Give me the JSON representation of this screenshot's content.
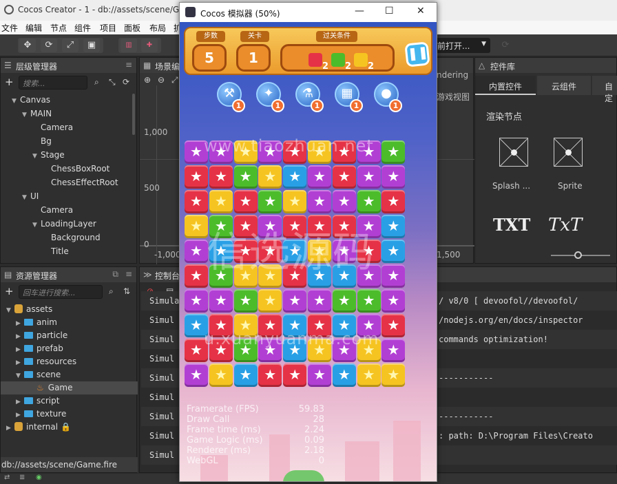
{
  "editor": {
    "title": "Cocos Creator - 1 - db://assets/scene/Game",
    "menu": [
      "文件",
      "编辑",
      "节点",
      "组件",
      "项目",
      "面板",
      "布局",
      "扩"
    ]
  },
  "toolbar": {
    "open_label": "前打开...",
    "buttons": [
      "move-icon",
      "rotate-icon",
      "scale-icon",
      "rect-icon"
    ]
  },
  "hierarchy": {
    "title": "层级管理器",
    "search_placeholder": "搜索...",
    "nodes": [
      {
        "label": "Canvas",
        "depth": 0,
        "expanded": true
      },
      {
        "label": "MAIN",
        "depth": 1,
        "expanded": true
      },
      {
        "label": "Camera",
        "depth": 2
      },
      {
        "label": "Bg",
        "depth": 2
      },
      {
        "label": "Stage",
        "depth": 2,
        "expanded": true
      },
      {
        "label": "ChessBoxRoot",
        "depth": 3
      },
      {
        "label": "ChessEffectRoot",
        "depth": 3
      },
      {
        "label": "UI",
        "depth": 1,
        "expanded": true
      },
      {
        "label": "Camera",
        "depth": 2
      },
      {
        "label": "LoadingLayer",
        "depth": 2,
        "expanded": true
      },
      {
        "label": "Background",
        "depth": 3
      },
      {
        "label": "Title",
        "depth": 3
      }
    ]
  },
  "scene": {
    "title": "场景编",
    "labels": {
      "y1000": "1,000",
      "y500": "500",
      "y0": "0",
      "xm1000": "-1,000",
      "x1500": "1,500",
      "rendering": "ndering",
      "view": "游戏视图"
    }
  },
  "assets": {
    "title": "资源管理器",
    "search_placeholder": "回车进行搜索...",
    "root": "assets",
    "items": [
      {
        "label": "anim"
      },
      {
        "label": "particle"
      },
      {
        "label": "prefab"
      },
      {
        "label": "resources"
      },
      {
        "label": "scene"
      },
      {
        "label": "Game"
      },
      {
        "label": "script"
      },
      {
        "label": "texture"
      }
    ],
    "internal": "internal",
    "footer_path": "db://assets/scene/Game.fire"
  },
  "widgets": {
    "title": "控件库",
    "tabs": [
      "内置控件",
      "云组件",
      "自定"
    ],
    "section": "渲染节点",
    "items": [
      "Splash ...",
      "Sprite"
    ],
    "txt1": "TXT",
    "txt2": "TxT"
  },
  "console": {
    "title": "控制台",
    "rows": [
      {
        "left": "Simula",
        "right": "/ v8/0 [ devoofol//devoofol/"
      },
      {
        "left": "Simul",
        "right": "/nodejs.org/en/docs/inspector"
      },
      {
        "left": "Simul",
        "right": "commands optimization!"
      },
      {
        "left": "Simul",
        "right": ""
      },
      {
        "left": "Simul",
        "right": "-----------"
      },
      {
        "left": "Simul",
        "right": ""
      },
      {
        "left": "Simul",
        "right": "-----------"
      },
      {
        "left": "Simul",
        "right": ": path: D:\\Program Files\\Creato"
      },
      {
        "left": "Simul",
        "right": ""
      }
    ]
  },
  "simulator": {
    "title": "Cocos 模拟器 (50%)",
    "hud": {
      "steps_label": "步数",
      "steps_value": "5",
      "level_label": "关卡",
      "level_value": "1",
      "goal_label": "过关条件",
      "goals": [
        {
          "color": "#e63246",
          "count": "2"
        },
        {
          "color": "#4cbc2b",
          "count": "2"
        },
        {
          "color": "#f6c421",
          "count": "2"
        }
      ]
    },
    "props": [
      {
        "icon": "hammer-icon",
        "glyph": "🔨",
        "count": "1"
      },
      {
        "icon": "wand-icon",
        "glyph": "✦",
        "count": "1"
      },
      {
        "icon": "potion-icon",
        "glyph": "⚗",
        "count": "1"
      },
      {
        "icon": "shuffle-icon",
        "glyph": "▦",
        "count": "1"
      },
      {
        "icon": "bomb-icon",
        "glyph": "●",
        "count": "1"
      }
    ],
    "board": [
      [
        "pur",
        "pur",
        "yel",
        "pur",
        "red",
        "yel",
        "red",
        "pur",
        "grn"
      ],
      [
        "red",
        "red",
        "grn",
        "yel",
        "blu",
        "pur",
        "red",
        "pur",
        "pur"
      ],
      [
        "red",
        "yel",
        "red",
        "grn",
        "yel",
        "pur",
        "pur",
        "grn",
        "red"
      ],
      [
        "yel",
        "grn",
        "red",
        "pur",
        "red",
        "red",
        "red",
        "pur",
        "blu"
      ],
      [
        "pur",
        "blu",
        "red",
        "red",
        "blu",
        "yel",
        "pur",
        "red",
        "blu"
      ],
      [
        "red",
        "grn",
        "yel",
        "yel",
        "red",
        "blu",
        "blu",
        "pur",
        "pur"
      ],
      [
        "pur",
        "pur",
        "grn",
        "yel",
        "pur",
        "pur",
        "grn",
        "grn",
        "pur"
      ],
      [
        "blu",
        "red",
        "yel",
        "red",
        "blu",
        "red",
        "blu",
        "pur",
        "red"
      ],
      [
        "red",
        "red",
        "grn",
        "pur",
        "blu",
        "yel",
        "pur",
        "yel",
        "pur"
      ],
      [
        "pur",
        "yel",
        "blu",
        "red",
        "red",
        "pur",
        "blu",
        "yel",
        "yel"
      ]
    ],
    "stats": [
      {
        "label": "Framerate (FPS)",
        "value": "59.83"
      },
      {
        "label": "Draw Call",
        "value": "28"
      },
      {
        "label": "Frame time (ms)",
        "value": "2.24"
      },
      {
        "label": "Game Logic (ms)",
        "value": "0.09"
      },
      {
        "label": "Renderer (ms)",
        "value": "2.18"
      },
      {
        "label": "WebGL",
        "value": "0"
      }
    ]
  },
  "watermarks": {
    "wm1": "www.tiaozhuan.net",
    "wm2": "信选源码",
    "wm3": "u.xuanyuanma.com"
  }
}
